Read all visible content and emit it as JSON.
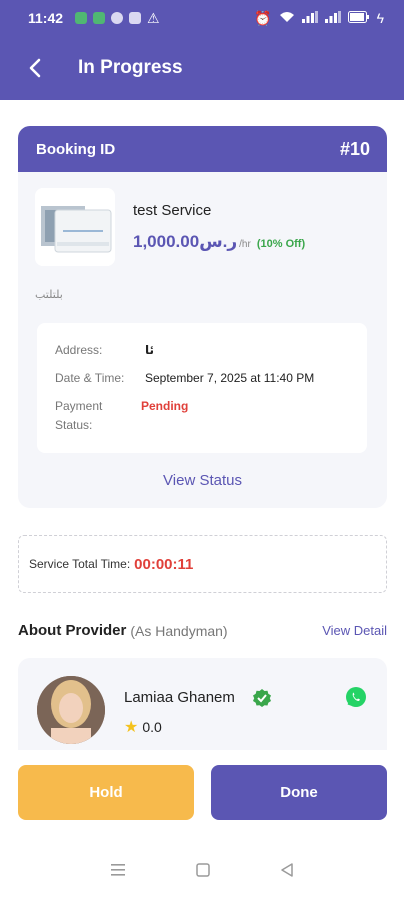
{
  "status_bar": {
    "time": "11:42"
  },
  "app_bar": {
    "title": "In Progress"
  },
  "booking": {
    "label": "Booking ID",
    "number": "#10",
    "service_name": "test Service",
    "price": "1,000.00ر.س",
    "per_unit": "/hr",
    "discount": "(10% Off)",
    "description": "بلتلتب",
    "address_label": "Address:",
    "address_value": "ئا",
    "datetime_label": "Date & Time:",
    "datetime_value": "September 7, 2025 at 11:40 PM",
    "payment_label_1": "Payment",
    "payment_label_2": "Status:",
    "payment_value": "Pending",
    "view_status": "View Status"
  },
  "timer": {
    "label": "Service Total Time:",
    "value": "00:00:11"
  },
  "provider": {
    "title": "About Provider",
    "role": "(As Handyman)",
    "view_detail": "View Detail",
    "name": "Lamiaa Ghanem",
    "rating": "0.0"
  },
  "actions": {
    "hold": "Hold",
    "done": "Done"
  },
  "icons": {
    "back": "arrow-left-icon",
    "verified": "verified-badge-icon",
    "whatsapp": "whatsapp-icon",
    "star": "star-icon"
  },
  "colors": {
    "primary": "#5b56b3",
    "hold": "#f7ba4c",
    "pending": "#e0403a",
    "discount": "#3aa64b",
    "whatsapp": "#25d366",
    "card_bg": "#f5f6fa"
  }
}
